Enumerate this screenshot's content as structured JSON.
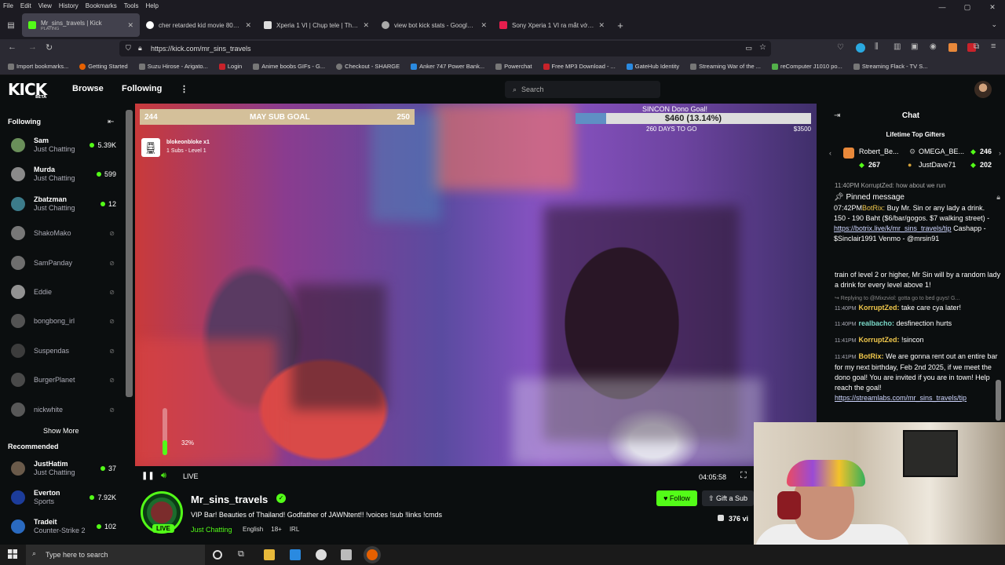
{
  "menubar": {
    "items": [
      "File",
      "Edit",
      "View",
      "History",
      "Bookmarks",
      "Tools",
      "Help"
    ],
    "window_controls": [
      "—",
      "▢",
      "✕"
    ]
  },
  "tabs": [
    {
      "title": "Mr_sins_travels | Kick",
      "subtitle": "PLAYING",
      "color": "#53fc18",
      "active": true
    },
    {
      "title": "cher retarded kid movie 80s - G",
      "color": "#4285f4"
    },
    {
      "title": "Xperia 1 VI | Chụp tele | Thời lư",
      "color": "#e0e0e0"
    },
    {
      "title": "view bot kick stats - Google Sea",
      "color": "#aaaaaa"
    },
    {
      "title": "Sony Xperia 1 VI ra mắt với hệ",
      "color": "#e61e4d"
    }
  ],
  "new_tab": "+",
  "url": "https://kick.com/mr_sins_travels",
  "bookmarks": [
    "Import bookmarks...",
    "Getting Started",
    "Suzu Hirose - Arigato...",
    "Login",
    "Anime boobs GIFs - G...",
    "Checkout - SHARGE",
    "Anker 747 Power Bank...",
    "Powerchat",
    "Free MP3 Download - ...",
    "GateHub Identity",
    "Streaming War of the ...",
    "reComputer J1010 po...",
    "Streaming Flack - TV S..."
  ],
  "nav": {
    "logo": "KICK",
    "logo_sub": "BETA",
    "browse": "Browse",
    "following": "Following",
    "more": "⋮",
    "search_placeholder": "Search"
  },
  "sidebar": {
    "following_header": "Following",
    "following": [
      {
        "name": "Sam",
        "category": "Just Chatting",
        "viewers": "5.39K",
        "live": true,
        "color": "#6a8f5a"
      },
      {
        "name": "Murda",
        "category": "Just Chatting",
        "viewers": "599",
        "live": true,
        "color": "#8a8a8a"
      },
      {
        "name": "Zbatzman",
        "category": "Just Chatting",
        "viewers": "12",
        "live": true,
        "color": "#3c7b8a"
      },
      {
        "name": "ShakoMako",
        "live": false,
        "color": "#c9a0b0"
      },
      {
        "name": "SamPanday",
        "live": false,
        "color": "#b39a7a"
      },
      {
        "name": "Eddie",
        "live": false,
        "color": "#d0d0d0"
      },
      {
        "name": "bongbong_irl",
        "live": false,
        "color": "#777777"
      },
      {
        "name": "Suspendas",
        "live": false,
        "color": "#555555"
      },
      {
        "name": "BurgerPlanet",
        "live": false,
        "color": "#4a6ab0"
      },
      {
        "name": "nickwhite",
        "live": false,
        "color": "#b07070"
      }
    ],
    "show_more": "Show More",
    "recommended_header": "Recommended",
    "recommended": [
      {
        "name": "JustHatim",
        "category": "Just Chatting",
        "viewers": "37",
        "color": "#6a5a4a"
      },
      {
        "name": "Everton",
        "category": "Sports",
        "viewers": "7.92K",
        "color": "#1c3c9a"
      },
      {
        "name": "Tradeit",
        "category": "Counter-Strike 2",
        "viewers": "102",
        "color": "#2a6ac0"
      }
    ]
  },
  "overlay": {
    "sub_goal": {
      "current": "244",
      "label": "MAY SUB GOAL",
      "target": "250"
    },
    "dono_goal": {
      "title": "SINCON Dono Goal!",
      "amount": "$460 (13.14%)",
      "progress": 0.1314,
      "days_left": "260 DAYS TO GO",
      "max": "$3500"
    },
    "sub_alert": {
      "line1": "blokeonbloke x1",
      "line2": "1 Subs - Level 1"
    },
    "volume": {
      "label": "32%",
      "level": 0.32
    }
  },
  "player": {
    "live_label": "LIVE",
    "time": "04:05:58"
  },
  "stream": {
    "channel": "Mr_sins_travels",
    "title": "VIP Bar! Beauties of Thailand! Godfather of JAWNtent!! !voices !sub !links !cmds",
    "category": "Just Chatting",
    "tags": [
      "English",
      "18+",
      "IRL"
    ],
    "live_badge": "LIVE",
    "follow": "♥ Follow",
    "gift": "⇧ Gift a Sub",
    "viewers": "376 vi"
  },
  "chat": {
    "header": "Chat",
    "lifetime_label": "Lifetime Top Gifters",
    "gifters": [
      {
        "name": "Robert_Be...",
        "count": "267"
      },
      {
        "name": "OMEGA_BE...",
        "count": "246"
      },
      {
        "name": "JustDave71",
        "count": "202"
      }
    ],
    "cut_top": "11:40PM  KorruptZed: how about we run",
    "pinned_title": "Pinned message",
    "pinned_time": "07:42PM",
    "pinned_user": "BotRix:",
    "pinned_text": "Buy Mr. Sin or any lady a drink. 150 - 190 Baht ($6/bar/gogos. $7 walking street) - ",
    "pinned_link": "https://botrix.live/k/mr_sins_travels/tip",
    "pinned_tail": " Cashapp - $Sinclair1991 Venmo - @mrsin91",
    "messages": [
      {
        "time": "",
        "user": "",
        "color": "#ffffff",
        "text": "train of level 2 or higher, Mr Sin will by a random lady a drink for every level above 1!"
      },
      {
        "reply": "↪ Replying to @Mixzviol: gotta go to bed guys! G..."
      },
      {
        "time": "11:40PM",
        "user": "KorruptZed:",
        "color": "#f2c94c",
        "text": "take care cya later!"
      },
      {
        "time": "11:40PM",
        "user": "realbacho:",
        "color": "#7ad9c8",
        "text": "desfinection hurts"
      },
      {
        "time": "11:41PM",
        "user": "KorruptZed:",
        "color": "#f2c94c",
        "text": "!sincon"
      },
      {
        "time": "11:41PM",
        "user": "BotRix:",
        "color": "#f2c94c",
        "text": "We are gonna rent out an entire bar for my next birthday, Feb 2nd 2025, if we meet the dono goal! You are invited if you are in town! Help reach the goal! ",
        "link": "https://streamlabs.com/mr_sins_travels/tip"
      }
    ]
  },
  "taskbar": {
    "search_placeholder": "Type here to search"
  }
}
